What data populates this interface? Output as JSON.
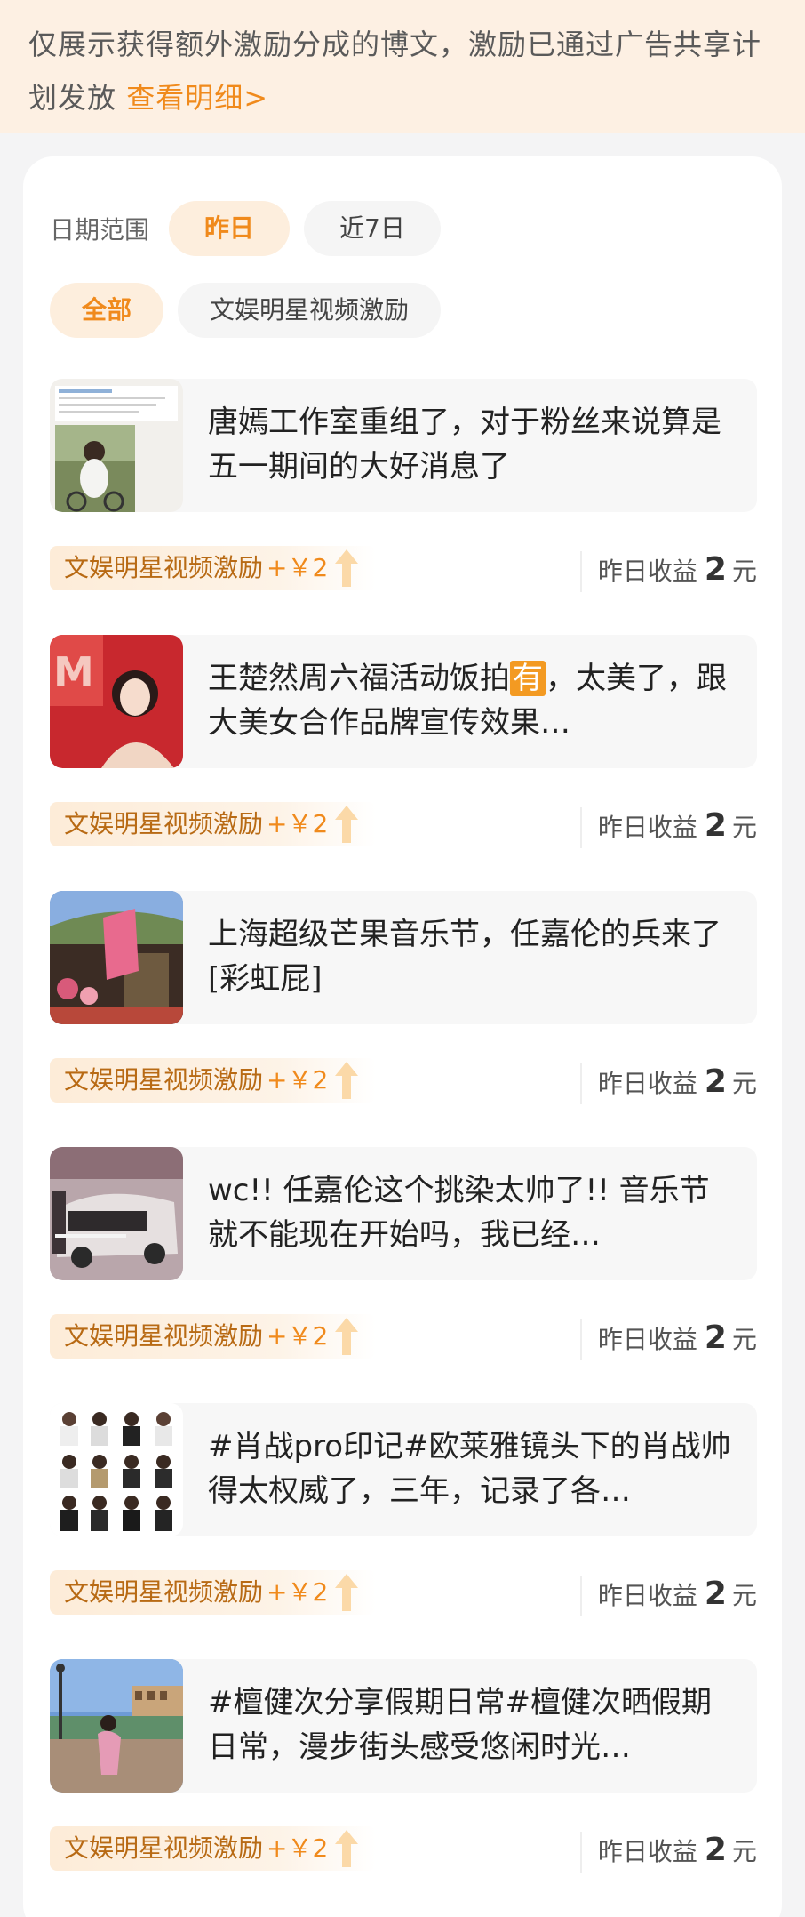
{
  "notice": {
    "text": "仅展示获得额外激励分成的博文，激励已通过广告共享计划发放 ",
    "link": "查看明细>"
  },
  "date_filter": {
    "label": "日期范围",
    "options": [
      "昨日",
      "近7日"
    ],
    "selected": "昨日"
  },
  "type_filter": {
    "options": [
      "全部",
      "文娱明星视频激励"
    ],
    "selected": "全部"
  },
  "colors": {
    "accent": "#f08a1c",
    "notice_bg": "#fdf0e3"
  },
  "posts": [
    {
      "title": "唐嫣工作室重组了，对于粉丝来说算是五一期间的大好消息了",
      "reward_label": "文娱明星视频激励",
      "reward_amount": "+￥2",
      "earn_label": "昨日收益",
      "earn_value": "2",
      "earn_unit": "元"
    },
    {
      "title_before": "王楚然周六福活动饭拍",
      "title_highlight": "有",
      "title_after": "，太美了，跟大美女合作品牌宣传效果…",
      "reward_label": "文娱明星视频激励",
      "reward_amount": "+￥2",
      "earn_label": "昨日收益",
      "earn_value": "2",
      "earn_unit": "元"
    },
    {
      "title": "上海超级芒果音乐节，任嘉伦的兵来了[彩虹屁]",
      "reward_label": "文娱明星视频激励",
      "reward_amount": "+￥2",
      "earn_label": "昨日收益",
      "earn_value": "2",
      "earn_unit": "元"
    },
    {
      "title": "wc!! 任嘉伦这个挑染太帅了!! 音乐节就不能现在开始吗，我已经…",
      "reward_label": "文娱明星视频激励",
      "reward_amount": "+￥2",
      "earn_label": "昨日收益",
      "earn_value": "2",
      "earn_unit": "元"
    },
    {
      "title": "#肖战pro印记#欧莱雅镜头下的肖战帅得太权威了，三年，记录了各…",
      "reward_label": "文娱明星视频激励",
      "reward_amount": "+￥2",
      "earn_label": "昨日收益",
      "earn_value": "2",
      "earn_unit": "元"
    },
    {
      "title": "#檀健次分享假期日常#檀健次晒假期日常，漫步街头感受悠闲时光…",
      "reward_label": "文娱明星视频激励",
      "reward_amount": "+￥2",
      "earn_label": "昨日收益",
      "earn_value": "2",
      "earn_unit": "元"
    }
  ]
}
